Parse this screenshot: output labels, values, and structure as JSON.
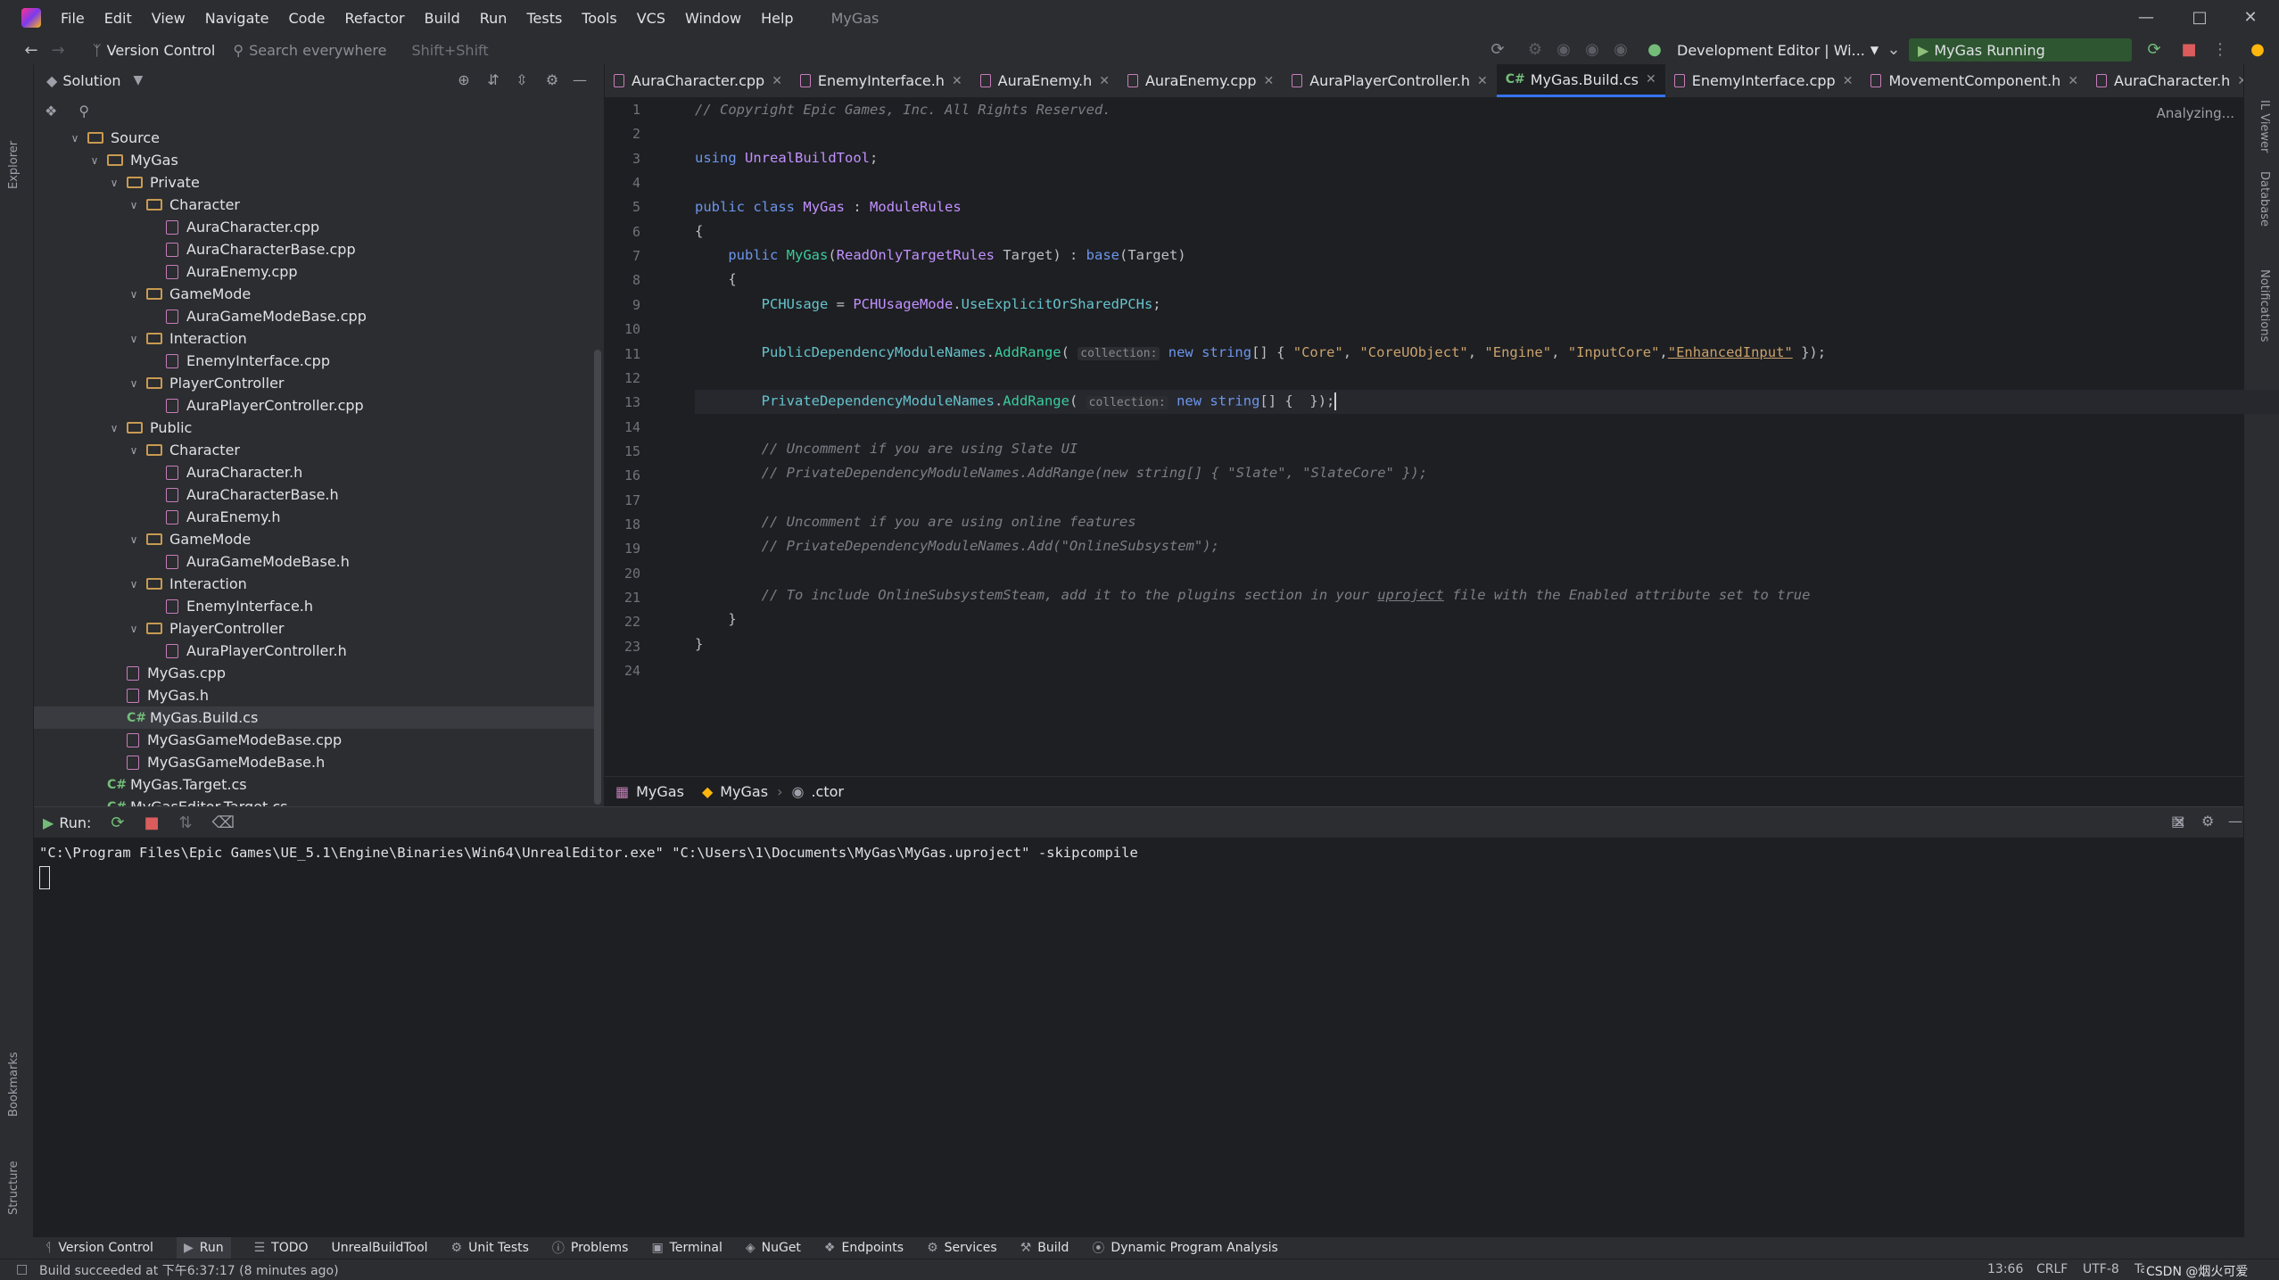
{
  "menu": [
    "File",
    "Edit",
    "View",
    "Navigate",
    "Code",
    "Refactor",
    "Build",
    "Run",
    "Tests",
    "Tools",
    "VCS",
    "Window",
    "Help"
  ],
  "window_title": "MyGas",
  "toolbar": {
    "version_control": "Version Control",
    "search_placeholder": "Search everywhere",
    "search_shortcut": "Shift+Shift",
    "run_config": "Development Editor | Wi...",
    "running_label": "MyGas Running"
  },
  "solution": {
    "header": "Solution",
    "tree": [
      {
        "label": "Source",
        "type": "folder",
        "level": 0,
        "expanded": true
      },
      {
        "label": "MyGas",
        "type": "folder",
        "level": 1,
        "expanded": true
      },
      {
        "label": "Private",
        "type": "folder",
        "level": 2,
        "expanded": true
      },
      {
        "label": "Character",
        "type": "folder",
        "level": 3,
        "expanded": true
      },
      {
        "label": "AuraCharacter.cpp",
        "type": "cpp",
        "level": 4
      },
      {
        "label": "AuraCharacterBase.cpp",
        "type": "cpp",
        "level": 4
      },
      {
        "label": "AuraEnemy.cpp",
        "type": "cpp",
        "level": 4
      },
      {
        "label": "GameMode",
        "type": "folder",
        "level": 3,
        "expanded": true
      },
      {
        "label": "AuraGameModeBase.cpp",
        "type": "cpp",
        "level": 4
      },
      {
        "label": "Interaction",
        "type": "folder",
        "level": 3,
        "expanded": true
      },
      {
        "label": "EnemyInterface.cpp",
        "type": "cpp",
        "level": 4
      },
      {
        "label": "PlayerController",
        "type": "folder",
        "level": 3,
        "expanded": true
      },
      {
        "label": "AuraPlayerController.cpp",
        "type": "cpp",
        "level": 4
      },
      {
        "label": "Public",
        "type": "folder",
        "level": 2,
        "expanded": true
      },
      {
        "label": "Character",
        "type": "folder",
        "level": 3,
        "expanded": true
      },
      {
        "label": "AuraCharacter.h",
        "type": "h",
        "level": 4
      },
      {
        "label": "AuraCharacterBase.h",
        "type": "h",
        "level": 4
      },
      {
        "label": "AuraEnemy.h",
        "type": "h",
        "level": 4
      },
      {
        "label": "GameMode",
        "type": "folder",
        "level": 3,
        "expanded": true
      },
      {
        "label": "AuraGameModeBase.h",
        "type": "h",
        "level": 4
      },
      {
        "label": "Interaction",
        "type": "folder",
        "level": 3,
        "expanded": true
      },
      {
        "label": "EnemyInterface.h",
        "type": "h",
        "level": 4
      },
      {
        "label": "PlayerController",
        "type": "folder",
        "level": 3,
        "expanded": true
      },
      {
        "label": "AuraPlayerController.h",
        "type": "h",
        "level": 4
      },
      {
        "label": "MyGas.cpp",
        "type": "cpp",
        "level": 2
      },
      {
        "label": "MyGas.h",
        "type": "h",
        "level": 2
      },
      {
        "label": "MyGas.Build.cs",
        "type": "cs",
        "level": 2,
        "selected": true
      },
      {
        "label": "MyGasGameModeBase.cpp",
        "type": "cpp",
        "level": 2
      },
      {
        "label": "MyGasGameModeBase.h",
        "type": "h",
        "level": 2
      },
      {
        "label": "MyGas.Target.cs",
        "type": "cs",
        "level": 1
      },
      {
        "label": "MyGasEditor.Target.cs",
        "type": "cs",
        "level": 1
      }
    ]
  },
  "tabs": [
    {
      "label": "AuraCharacter.cpp",
      "type": "cpp"
    },
    {
      "label": "EnemyInterface.h",
      "type": "h"
    },
    {
      "label": "AuraEnemy.h",
      "type": "h"
    },
    {
      "label": "AuraEnemy.cpp",
      "type": "cpp"
    },
    {
      "label": "AuraPlayerController.h",
      "type": "h"
    },
    {
      "label": "MyGas.Build.cs",
      "type": "cs",
      "active": true
    },
    {
      "label": "EnemyInterface.cpp",
      "type": "cpp"
    },
    {
      "label": "MovementComponent.h",
      "type": "h"
    },
    {
      "label": "AuraCharacter.h",
      "type": "h"
    }
  ],
  "analyzing": "Analyzing...",
  "code": {
    "line_numbers": [
      "1",
      "2",
      "3",
      "4",
      "5",
      "6",
      "7",
      "8",
      "9",
      "10",
      "11",
      "12",
      "13",
      "14",
      "15",
      "16",
      "17",
      "18",
      "19",
      "20",
      "21",
      "22",
      "23",
      "24"
    ],
    "l1": "// Copyright Epic Games, Inc. All Rights Reserved.",
    "l3_kw": "using",
    "l3_ns": "UnrealBuildTool",
    "l5_kw1": "public",
    "l5_kw2": "class",
    "l5_name": "MyGas",
    "l5_base": "ModuleRules",
    "l7_kw": "public",
    "l7_fn": "MyGas",
    "l7_ty": "ReadOnlyTargetRules",
    "l7_param": "Target",
    "l7_base": "base",
    "l9_id": "PCHUsage",
    "l9_ty": "PCHUsageMode",
    "l9_val": "UseExplicitOrSharedPCHs",
    "l11_id": "PublicDependencyModuleNames",
    "l11_fn": "AddRange",
    "hint_collection": "collection:",
    "kw_new": "new",
    "kw_string": "string",
    "l11_s1": "\"Core\"",
    "l11_s2": "\"CoreUObject\"",
    "l11_s3": "\"Engine\"",
    "l11_s4": "\"InputCore\"",
    "l11_s5": "\"EnhancedInput\"",
    "l13_id": "PrivateDependencyModuleNames",
    "l15": "// Uncomment if you are using Slate UI",
    "l16": "// PrivateDependencyModuleNames.AddRange(new string[] { \"Slate\", \"SlateCore\" });",
    "l18": "// Uncomment if you are using online features",
    "l19": "// PrivateDependencyModuleNames.Add(\"OnlineSubsystem\");",
    "l21a": "// To include OnlineSubsystemSteam, add it to the plugins section in your ",
    "l21b": "uproject",
    "l21c": " file with the Enabled attribute set to true"
  },
  "breadcrumbs": [
    "MyGas",
    "MyGas",
    ".ctor"
  ],
  "run": {
    "label": "Run:",
    "command": "\"C:\\Program Files\\Epic Games\\UE_5.1\\Engine\\Binaries\\Win64\\UnrealEditor.exe\" \"C:\\Users\\1\\Documents\\MyGas\\MyGas.uproject\" -skipcompile"
  },
  "bottom_tools": [
    "Version Control",
    "Run",
    "TODO",
    "UnrealBuildTool",
    "Unit Tests",
    "Problems",
    "Terminal",
    "NuGet",
    "Endpoints",
    "Services",
    "Build",
    "Dynamic Program Analysis"
  ],
  "left_strip": {
    "explorer": "Explorer",
    "bookmarks": "Bookmarks",
    "structure": "Structure"
  },
  "right_strip": {
    "il_viewer": "IL Viewer",
    "database": "Database",
    "notifications": "Notifications"
  },
  "status": {
    "message": "Build succeeded at 下午6:37:17 (8 minutes ago)",
    "position": "13:66",
    "line_sep": "CRLF",
    "encoding": "UTF-8",
    "indent": "Tab",
    "watermark": "CSDN @烟火可爱"
  }
}
